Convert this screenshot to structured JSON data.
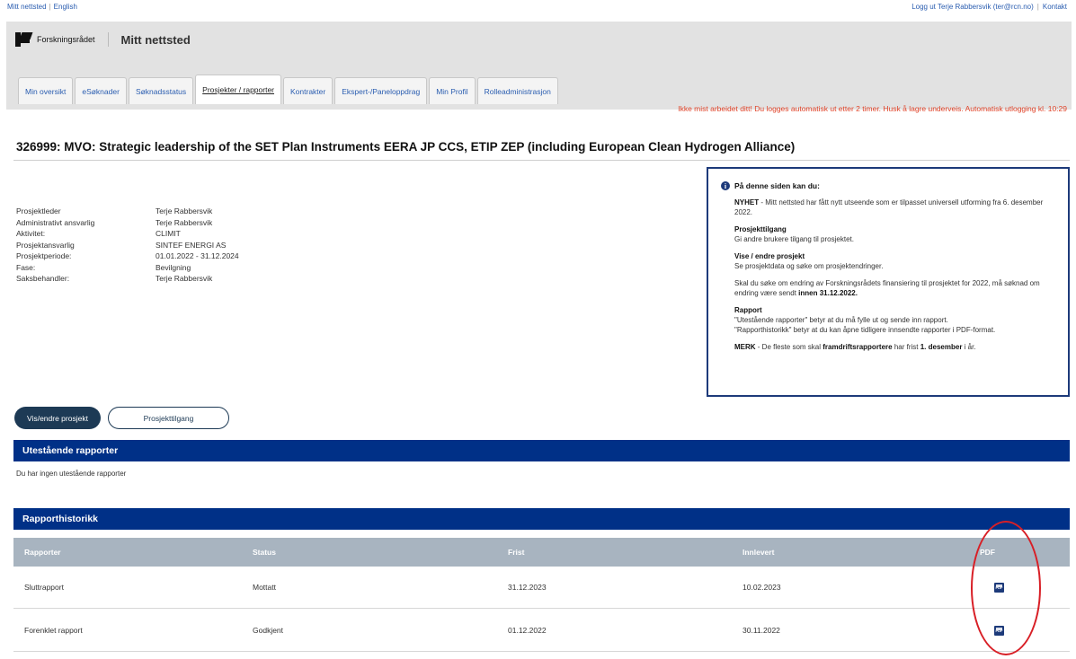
{
  "topbar": {
    "links": [
      "Mitt nettsted",
      "English"
    ],
    "logout": "Logg ut Terje Rabbersvik (ter@rcn.no)",
    "contact": "Kontakt"
  },
  "brand": {
    "name": "Forskningsrådet",
    "site": "Mitt nettsted"
  },
  "tabs": [
    "Min oversikt",
    "eSøknader",
    "Søknadsstatus",
    "Prosjekter / rapporter",
    "Kontrakter",
    "Ekspert-/Paneloppdrag",
    "Min Profil",
    "Rolleadministrasjon"
  ],
  "notice": "Ikke mist arbeidet ditt! Du logges automatisk ut etter 2 timer. Husk å lagre underveis. Automatisk utlogging kl. 10:29",
  "project": {
    "title": "326999: MVO: Strategic leadership of the SET Plan Instruments EERA JP CCS, ETIP ZEP (including European Clean Hydrogen Alliance)",
    "details": [
      {
        "label": "Prosjektleder",
        "value": "Terje Rabbersvik"
      },
      {
        "label": "Administrativt ansvarlig",
        "value": "Terje Rabbersvik"
      },
      {
        "label": "Aktivitet:",
        "value": "CLIMIT"
      },
      {
        "label": "Prosjektansvarlig",
        "value": "SINTEF ENERGI AS"
      },
      {
        "label": "Prosjektperiode:",
        "value": "01.01.2022 - 31.12.2024"
      },
      {
        "label": "Fase:",
        "value": "Bevilgning"
      },
      {
        "label": "Saksbehandler:",
        "value": "Terje Rabbersvik"
      }
    ]
  },
  "info": {
    "heading": "På denne siden kan du:",
    "news_bold": "NYHET",
    "news_text": " - Mitt nettsted har fått nytt utseende som er tilpasset universell utforming fra 6. desember 2022.",
    "access_title": "Prosjekttilgang",
    "access_text": "Gi andre brukere tilgang til prosjektet.",
    "view_title": "Vise / endre prosjekt",
    "view_text": "Se prosjektdata og søke om prosjektendringer.",
    "change_text": "Skal du søke om endring av Forskningsrådets finansiering til prosjektet for 2022, må søknad om endring være sendt ",
    "change_bold": "innen 31.12.2022.",
    "report_title": "Rapport",
    "report_line1": "\"Utestående rapporter\" betyr at du må fylle ut og sende inn rapport.",
    "report_line2": "\"Rapporthistorikk\" betyr at du kan åpne tidligere innsendte rapporter i PDF-format.",
    "merk_bold": "MERK",
    "merk_text1": " - De fleste som skal ",
    "merk_bold2": "framdriftsrapportere",
    "merk_text2": " har frist ",
    "merk_bold3": "1. desember",
    "merk_text3": " i år."
  },
  "buttons": {
    "view_edit": "Vis/endre prosjekt",
    "access": "Prosjekttilgang"
  },
  "outstanding": {
    "title": "Utestående rapporter",
    "empty": "Du har ingen utestående rapporter"
  },
  "history": {
    "title": "Rapporthistorikk",
    "columns": [
      "Rapporter",
      "Status",
      "Frist",
      "Innlevert",
      "PDF"
    ],
    "rows": [
      {
        "report": "Sluttrapport",
        "status": "Mottatt",
        "deadline": "31.12.2023",
        "submitted": "10.02.2023"
      },
      {
        "report": "Forenklet rapport",
        "status": "Godkjent",
        "deadline": "01.12.2022",
        "submitted": "30.11.2022"
      }
    ]
  },
  "colors": {
    "navy": "#003087",
    "button_dark": "#1d3a55",
    "notice_red": "#e0452b",
    "table_header": "#a8b4c0",
    "annotation_red": "#d81f26"
  },
  "icons": {
    "info": "info-icon",
    "pdf": "pdf-icon",
    "logo": "forskningsradet-logo"
  }
}
